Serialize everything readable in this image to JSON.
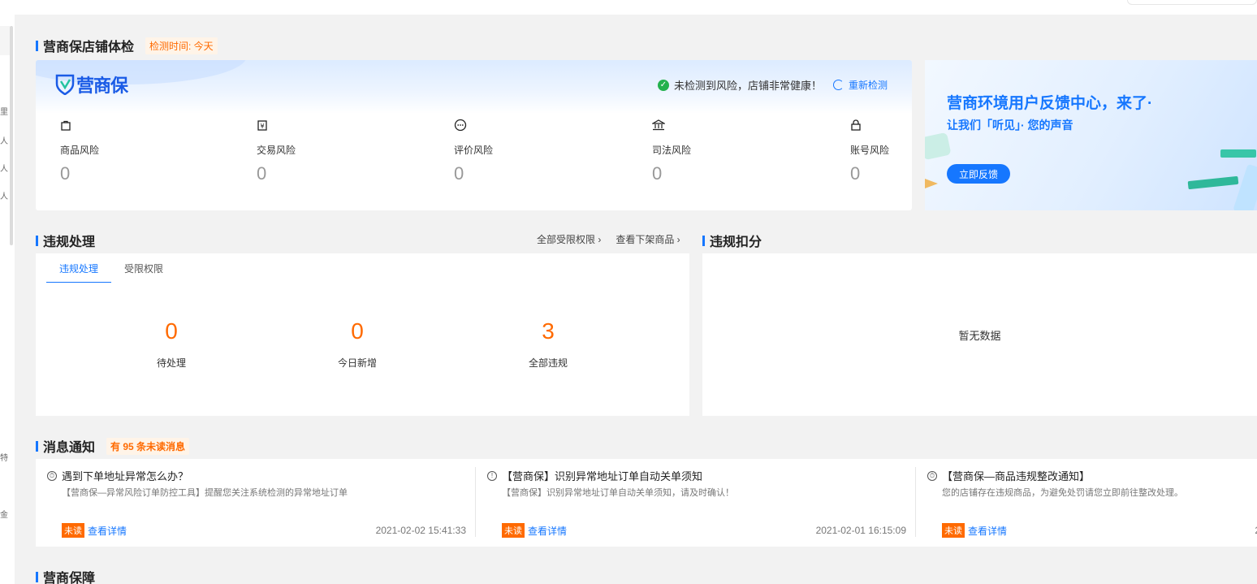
{
  "sidebar": {
    "fragments": [
      "里",
      "人",
      "人",
      "人",
      "特",
      "金"
    ]
  },
  "health": {
    "title": "营商保店铺体检",
    "check_time": "检测时间: 今天",
    "logo_text": "营商保",
    "status_text": "未检测到风险，店铺非常健康！",
    "recheck_label": "重新检测",
    "risks": [
      {
        "icon": "shopping-bag-icon",
        "glyph": "⌂",
        "label": "商品风险",
        "value": "0"
      },
      {
        "icon": "yen-receipt-icon",
        "glyph": "¥",
        "label": "交易风险",
        "value": "0"
      },
      {
        "icon": "chat-bubble-icon",
        "glyph": "…",
        "label": "评价风险",
        "value": "0"
      },
      {
        "icon": "courthouse-icon",
        "glyph": "⌂",
        "label": "司法风险",
        "value": "0"
      },
      {
        "icon": "lock-icon",
        "glyph": "🔒",
        "label": "账号风险",
        "value": "0"
      }
    ]
  },
  "banner": {
    "line1": "营商环境用户反馈中心，来了·",
    "line2": "让我们「听见」· 您的声音",
    "button": "立即反馈"
  },
  "violation": {
    "title": "违规处理",
    "links": [
      "全部受限权限 ›",
      "查看下架商品 ›"
    ],
    "tabs": [
      "违规处理",
      "受限权限"
    ],
    "stats": [
      {
        "value": "0",
        "label": "待处理"
      },
      {
        "value": "0",
        "label": "今日新增"
      },
      {
        "value": "3",
        "label": "全部违规"
      }
    ]
  },
  "points": {
    "title": "违规扣分",
    "empty_text": "暂无数据"
  },
  "notices": {
    "title": "消息通知",
    "unread_summary": "有 95 条未读消息",
    "items": [
      {
        "title": "遇到下单地址异常怎么办？",
        "desc": "【营商保—异常风险订单防控工具】提醒您关注系统检测的异常地址订单",
        "unread": "未读",
        "detail": "查看详情",
        "time": "2021-02-02 15:41:33"
      },
      {
        "title": "【营商保】识别异常地址订单自动关单须知",
        "desc": "【营商保】识别异常地址订单自动关单须知，请及时确认！",
        "unread": "未读",
        "detail": "查看详情",
        "time": "2021-02-01 16:15:09"
      },
      {
        "title": "【营商保—商品违规整改通知】",
        "desc": "您的店铺存在违规商品，为避免处罚请您立即前往整改处理。",
        "unread": "未读",
        "detail": "查看详情",
        "time": "2"
      }
    ]
  },
  "guarantee": {
    "title": "营商保障"
  },
  "colors": {
    "accent": "#1677ff",
    "warning": "#ff6a00",
    "success": "#23b14d"
  }
}
